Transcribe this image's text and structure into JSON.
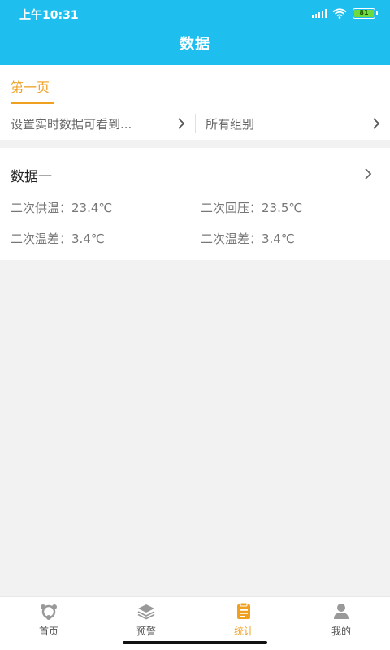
{
  "status_bar": {
    "time": "上午10:31",
    "battery": "81"
  },
  "header": {
    "title": "数据"
  },
  "tabs": {
    "active_label": "第一页"
  },
  "filters": {
    "left_label": "设置实时数据可看到...",
    "right_label": "所有组别"
  },
  "card": {
    "title": "数据一",
    "metrics": [
      "二次供温：23.4℃",
      "二次回压：23.5℃",
      "二次温差：3.4℃",
      "二次温差：3.4℃"
    ]
  },
  "tabbar": {
    "items": [
      {
        "label": "首页",
        "icon": "home-icon"
      },
      {
        "label": "预警",
        "icon": "layers-icon"
      },
      {
        "label": "统计",
        "icon": "clipboard-icon"
      },
      {
        "label": "我的",
        "icon": "user-icon"
      }
    ],
    "active_index": 2
  },
  "colors": {
    "header": "#1ebfee",
    "accent": "#f0a020",
    "background": "#f2f2f2",
    "icon_gray": "#999999"
  }
}
